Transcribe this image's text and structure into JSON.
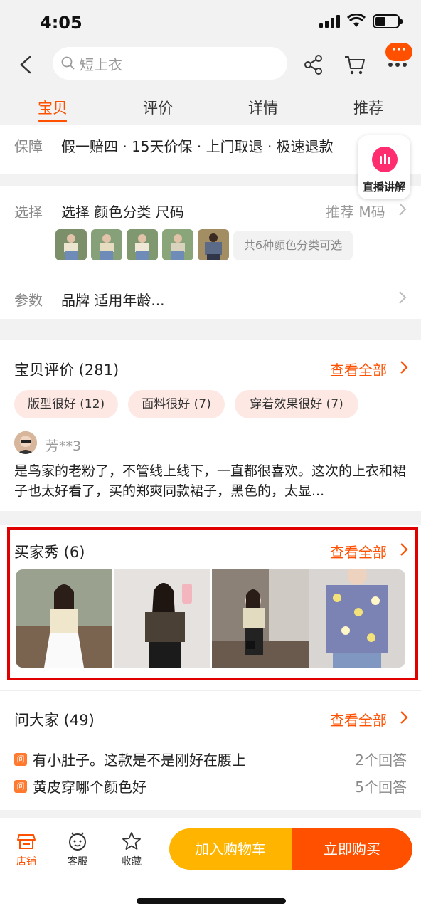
{
  "status": {
    "time": "4:05"
  },
  "search": {
    "placeholder": "短上衣"
  },
  "tabs": [
    "宝贝",
    "评价",
    "详情",
    "推荐"
  ],
  "guarantee": {
    "label": "保障",
    "text": "假一赔四 · 15天价保 · 上门取退 · 极速退款"
  },
  "live": {
    "label": "直播讲解"
  },
  "select": {
    "label": "选择",
    "text": "选择 颜色分类 尺码",
    "recommend": "推荐 M码",
    "colors_note": "共6种颜色分类可选"
  },
  "params": {
    "label": "参数",
    "text": "品牌 适用年龄..."
  },
  "reviews": {
    "title": "宝贝评价 (281)",
    "see_all": "查看全部",
    "tags": [
      "版型很好 (12)",
      "面料很好 (7)",
      "穿着效果很好 (7)"
    ],
    "reviewer": "芳**3",
    "text": "是鸟家的老粉了，不管线上线下，一直都很喜欢。这次的上衣和裙子也太好看了，买的郑爽同款裙子，黑色的，太显..."
  },
  "buyer_show": {
    "title": "买家秀 (6)",
    "see_all": "查看全部"
  },
  "qa": {
    "title": "问大家 (49)",
    "see_all": "查看全部",
    "icon": "问",
    "items": [
      {
        "q": "有小肚子。这款是不是刚好在腰上",
        "a": "2个回答"
      },
      {
        "q": "黄皮穿哪个颜色好",
        "a": "5个回答"
      }
    ]
  },
  "bottom": {
    "shop": "店铺",
    "service": "客服",
    "favorite": "收藏",
    "add_cart": "加入购物车",
    "buy_now": "立即购买"
  },
  "colors": {
    "accent": "#ff5000",
    "highlight": "#e00000",
    "cart_btn": "#ffb400"
  }
}
